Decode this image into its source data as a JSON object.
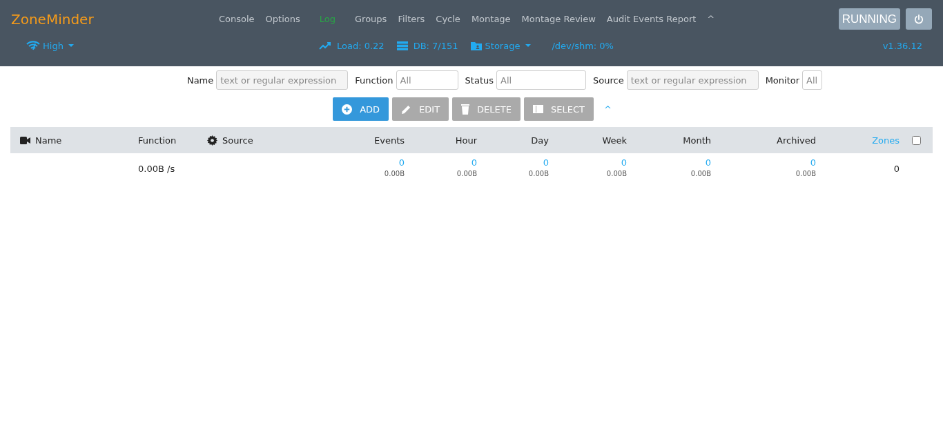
{
  "header": {
    "brand": "ZoneMinder",
    "nav": [
      {
        "label": "Console",
        "selected": false
      },
      {
        "label": "Options",
        "selected": false
      },
      {
        "label": "Log",
        "selected": true
      },
      {
        "label": "Groups",
        "selected": false
      },
      {
        "label": "Filters",
        "selected": false
      },
      {
        "label": "Cycle",
        "selected": false
      },
      {
        "label": "Montage",
        "selected": false
      },
      {
        "label": "Montage Review",
        "selected": false
      },
      {
        "label": "Audit Events Report",
        "selected": false
      }
    ],
    "collapse": "^",
    "state_button": "RUNNING",
    "bandwidth": "High",
    "load": "Load: 0.22",
    "db": "DB: 7/151",
    "storage": "Storage",
    "shm": "/dev/shm: 0%",
    "version": "v1.36.12"
  },
  "filters": [
    {
      "label": "Name",
      "placeholder": "text or regular expression",
      "kind": "text"
    },
    {
      "label": "Function",
      "placeholder": "All",
      "kind": "select"
    },
    {
      "label": "Status",
      "placeholder": "All",
      "kind": "select"
    },
    {
      "label": "Source",
      "placeholder": "text or regular expression",
      "kind": "text"
    },
    {
      "label": "Monitor",
      "placeholder": "All",
      "kind": "narrow"
    }
  ],
  "toolbar": {
    "buttons": [
      {
        "label": "ADD",
        "kind": "add",
        "disabled": false
      },
      {
        "label": "EDIT",
        "kind": "edit",
        "disabled": true
      },
      {
        "label": "DELETE",
        "kind": "delete",
        "disabled": true
      },
      {
        "label": "SELECT",
        "kind": "select",
        "disabled": true
      }
    ],
    "collapse": "^"
  },
  "table": {
    "columns": [
      {
        "label": "Name",
        "kind": "name"
      },
      {
        "label": "Function",
        "kind": "plain"
      },
      {
        "label": "Source",
        "kind": "source"
      },
      {
        "label": "Events",
        "kind": "num"
      },
      {
        "label": "Hour",
        "kind": "num"
      },
      {
        "label": "Day",
        "kind": "num"
      },
      {
        "label": "Week",
        "kind": "num"
      },
      {
        "label": "Month",
        "kind": "num"
      },
      {
        "label": "Archived",
        "kind": "num"
      },
      {
        "label": "Zones",
        "kind": "link"
      }
    ],
    "select_all": {
      "checked": false
    },
    "rows": [
      {
        "function": "0.00B /s",
        "counts": [
          {
            "count": "0",
            "size": "0.00B"
          },
          {
            "count": "0",
            "size": "0.00B"
          },
          {
            "count": "0",
            "size": "0.00B"
          },
          {
            "count": "0",
            "size": "0.00B"
          },
          {
            "count": "0",
            "size": "0.00B"
          },
          {
            "count": "0",
            "size": "0.00B"
          }
        ],
        "zones": "0"
      }
    ]
  }
}
